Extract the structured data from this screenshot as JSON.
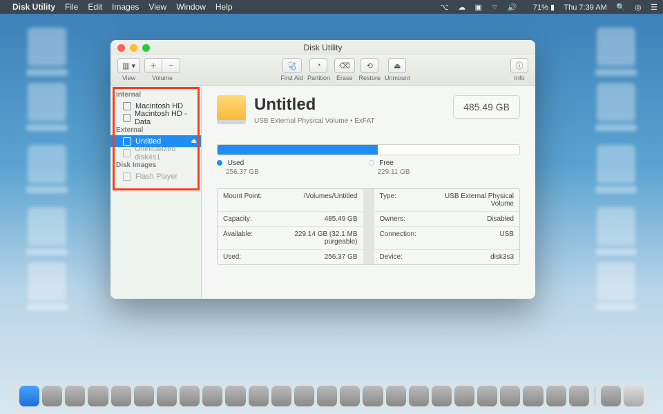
{
  "menubar": {
    "app": "Disk Utility",
    "items": [
      "File",
      "Edit",
      "Images",
      "View",
      "Window",
      "Help"
    ],
    "battery": "71%",
    "clock": "Thu 7:39 AM"
  },
  "window": {
    "title": "Disk Utility",
    "toolbar": {
      "view_label": "View",
      "volume_label": "Volume",
      "firstaid": "First Aid",
      "partition": "Partition",
      "erase": "Erase",
      "restore": "Restore",
      "unmount": "Unmount",
      "info": "Info"
    }
  },
  "sidebar": {
    "headers": {
      "internal": "Internal",
      "external": "External",
      "diskimages": "Disk Images"
    },
    "internal": [
      {
        "label": "Macintosh HD"
      },
      {
        "label": "Macintosh HD - Data"
      }
    ],
    "external": [
      {
        "label": "Untitled",
        "selected": true
      },
      {
        "label": "Uninitialized disk4s1",
        "dim": true
      }
    ],
    "diskimages": [
      {
        "label": "Flash Player",
        "dim": true
      }
    ]
  },
  "volume": {
    "name": "Untitled",
    "subtitle": "USB External Physical Volume • ExFAT",
    "capacity_badge": "485.49 GB",
    "used_label": "Used",
    "used_value": "256.37 GB",
    "free_label": "Free",
    "free_value": "229.11 GB",
    "used_pct": 53
  },
  "info": {
    "rows": [
      {
        "k1": "Mount Point:",
        "v1": "/Volumes/Untitled",
        "k2": "Type:",
        "v2": "USB External Physical Volume"
      },
      {
        "k1": "Capacity:",
        "v1": "485.49 GB",
        "k2": "Owners:",
        "v2": "Disabled"
      },
      {
        "k1": "Available:",
        "v1": "229.14 GB (32.1 MB purgeable)",
        "k2": "Connection:",
        "v2": "USB"
      },
      {
        "k1": "Used:",
        "v1": "256.37 GB",
        "k2": "Device:",
        "v2": "disk3s3"
      }
    ]
  }
}
